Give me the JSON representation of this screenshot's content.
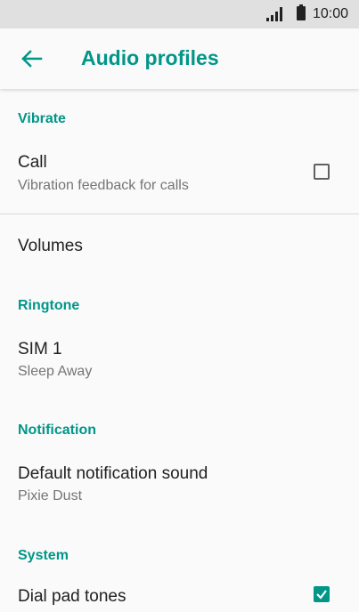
{
  "status_bar": {
    "time": "10:00"
  },
  "app_bar": {
    "title": "Audio profiles"
  },
  "sections": {
    "vibrate": "Vibrate",
    "ringtone": "Ringtone",
    "notification": "Notification",
    "system": "System"
  },
  "items": {
    "call": {
      "title": "Call",
      "subtitle": "Vibration feedback for calls",
      "checked": false
    },
    "volumes": {
      "title": "Volumes"
    },
    "sim1": {
      "title": "SIM 1",
      "subtitle": "Sleep Away"
    },
    "default_notification": {
      "title": "Default notification sound",
      "subtitle": "Pixie Dust"
    },
    "dial_pad_tones": {
      "title": "Dial pad tones",
      "checked": true
    }
  },
  "colors": {
    "accent": "#009688",
    "status_bar": "#e0e0e0",
    "background": "#fafafa"
  }
}
